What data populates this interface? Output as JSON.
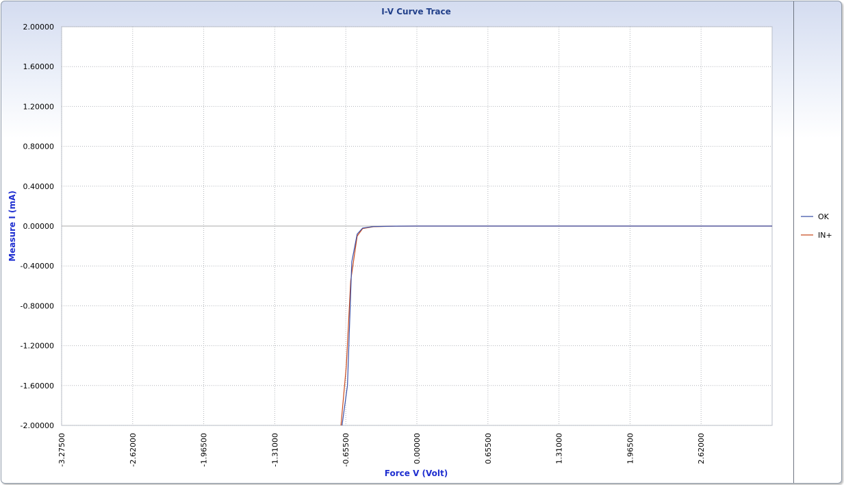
{
  "colors": {
    "title": "#22408a",
    "axis_title": "#1f2fd0",
    "grid": "#b0b4ba",
    "zero_line": "#a8a8a8",
    "series_ok": "#3a50a8",
    "series_in": "#c84a1e"
  },
  "chart_data": {
    "type": "line",
    "title": "I-V Curve Trace",
    "xlabel": "Force V (Volt)",
    "ylabel": "Measure I (mA)",
    "xlim": [
      -3.275,
      3.275
    ],
    "ylim": [
      -2.0,
      2.0
    ],
    "grid": true,
    "legend_position": "right",
    "x_ticks": [
      -3.275,
      -2.62,
      -1.965,
      -1.31,
      -0.655,
      0.0,
      0.655,
      1.31,
      1.965,
      2.62
    ],
    "x_tick_labels": [
      "-3.27500",
      "-2.62000",
      "-1.96500",
      "-1.31000",
      "-0.65500",
      "0.00000",
      "0.65500",
      "1.31000",
      "1.96500",
      "2.62000"
    ],
    "y_ticks": [
      2.0,
      1.6,
      1.2,
      0.8,
      0.4,
      0.0,
      -0.4,
      -0.8,
      -1.2,
      -1.6,
      -2.0
    ],
    "y_tick_labels": [
      "2.00000",
      "1.60000",
      "1.20000",
      "0.80000",
      "0.40000",
      "0.00000",
      "-0.40000",
      "-0.80000",
      "-1.20000",
      "-1.60000",
      "-2.00000"
    ],
    "series": [
      {
        "name": "OK",
        "color": "#3a50a8",
        "x": [
          -0.69,
          -0.64,
          -0.6,
          -0.55,
          -0.5,
          -0.4,
          -0.2,
          0.0,
          3.275
        ],
        "y": [
          -2.0,
          -1.6,
          -0.36,
          -0.08,
          -0.02,
          -0.005,
          -0.001,
          0.0,
          0.0
        ]
      },
      {
        "name": "IN+",
        "color": "#c84a1e",
        "x": [
          -0.7,
          -0.65,
          -0.61,
          -0.55,
          -0.5,
          -0.4,
          -0.2,
          0.0,
          3.275
        ],
        "y": [
          -2.0,
          -1.4,
          -0.55,
          -0.1,
          -0.025,
          -0.006,
          -0.001,
          0.0,
          0.0
        ]
      }
    ]
  }
}
